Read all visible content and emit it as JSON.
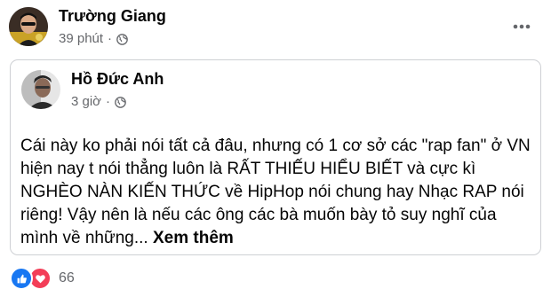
{
  "post": {
    "author": "Trường Giang",
    "time": "39 phút",
    "separator": "·",
    "privacy_icon": "globe-icon",
    "more_icon": "more-horizontal-icon"
  },
  "shared_post": {
    "author": "Hồ Đức Anh",
    "time": "3 giờ",
    "separator": "·",
    "privacy_icon": "globe-icon",
    "text": "Cái này ko phải nói tất cả đâu, nhưng có 1 cơ sở các \"rap fan\" ở VN hiện nay t nói thẳng luôn là RẤT THIẾU HIỂU BIẾT và cực kì NGHÈO NÀN KIẾN THỨC về HipHop nói chung hay Nhạc RAP nói riêng! Vậy nên là nếu các ông các bà muốn bày tỏ suy nghĩ của mình về những...",
    "see_more": "Xem thêm"
  },
  "reactions": {
    "icons": [
      "like-icon",
      "love-icon"
    ],
    "count": "66"
  },
  "colors": {
    "like": "#1877f2",
    "love": "#f33e58",
    "secondary_text": "#65676b",
    "border": "#ced0d4"
  }
}
